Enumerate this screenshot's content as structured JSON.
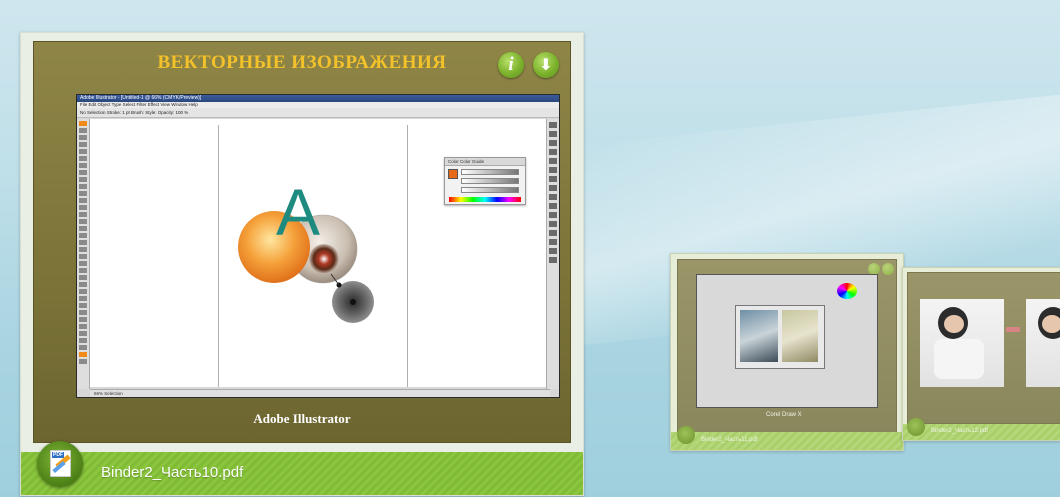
{
  "main_card": {
    "slide_title": "ВЕКТОРНЫЕ ИЗОБРАЖЕНИЯ",
    "info_button_label": "i",
    "download_button_label": "⬇",
    "slide_caption": "Adobe Illustrator",
    "file_name": "Binder2_Часть10.pdf",
    "file_icon_tag": "PDF",
    "app_screenshot": {
      "titlebar": "Adobe Illustrator - [Untitled-1 @ 66% (CMYK/Preview)]",
      "menu": "File  Edit  Object  Type  Select  Filter  Effect  View  Window  Help",
      "controlbar": "No Selection   Stroke:  1 pt   Brush:   Style:   Opacity: 100 %",
      "letter": "A",
      "panel_tab": "Color  Color Guide",
      "status": "66%   Selection"
    }
  },
  "background_cards": {
    "card2_caption": "Corel Draw X",
    "card2_file": "Binder2_Часть11.pdf",
    "card3_file": "Binder2_Часть12.pdf"
  },
  "colors": {
    "title_gold": "#f3c12a",
    "slide_olive": "#7d7538",
    "file_bar_green": "#8cc63f",
    "button_green": "#7cb22c"
  }
}
